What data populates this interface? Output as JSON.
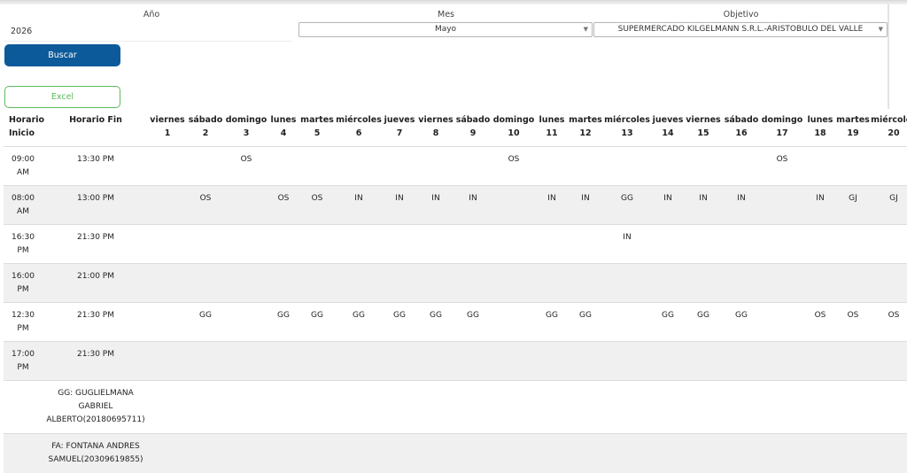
{
  "filters": {
    "year_label": "Año",
    "year_value": "2026",
    "month_label": "Mes",
    "month_value": "Mayo",
    "objective_label": "Objetivo",
    "objective_value": "SUPERMERCADO KILGELMANN S.R.L.-ARISTOBULO DEL VALLE",
    "caret_icon": "chevron-down-icon"
  },
  "buttons": {
    "buscar": "Buscar",
    "excel": "Excel",
    "buscar_color": "#0d5a9a",
    "excel_color": "#5cb85c"
  },
  "table": {
    "headers": {
      "start_line1": "Horario",
      "start_line2": "Inicio",
      "end": "Horario Fin"
    },
    "days": [
      {
        "name": "viernes",
        "num": "1"
      },
      {
        "name": "sábado",
        "num": "2"
      },
      {
        "name": "domingo",
        "num": "3"
      },
      {
        "name": "lunes",
        "num": "4"
      },
      {
        "name": "martes",
        "num": "5"
      },
      {
        "name": "miércoles",
        "num": "6"
      },
      {
        "name": "jueves",
        "num": "7"
      },
      {
        "name": "viernes",
        "num": "8"
      },
      {
        "name": "sábado",
        "num": "9"
      },
      {
        "name": "domingo",
        "num": "10"
      },
      {
        "name": "lunes",
        "num": "11"
      },
      {
        "name": "martes",
        "num": "12"
      },
      {
        "name": "miércoles",
        "num": "13"
      },
      {
        "name": "jueves",
        "num": "14"
      },
      {
        "name": "viernes",
        "num": "15"
      },
      {
        "name": "sábado",
        "num": "16"
      },
      {
        "name": "domingo",
        "num": "17"
      },
      {
        "name": "lunes",
        "num": "18"
      },
      {
        "name": "martes",
        "num": "19"
      },
      {
        "name": "miércoles",
        "num": "20"
      }
    ],
    "rows": [
      {
        "start_line1": "09:00",
        "start_line2": "AM",
        "end": "13:30 PM",
        "cells": [
          "",
          "",
          "OS",
          "",
          "",
          "",
          "",
          "",
          "",
          "OS",
          "",
          "",
          "",
          "",
          "",
          "",
          "OS",
          "",
          "",
          ""
        ]
      },
      {
        "start_line1": "08:00",
        "start_line2": "AM",
        "end": "13:00 PM",
        "cells": [
          "",
          "OS",
          "",
          "OS",
          "OS",
          "IN",
          "IN",
          "IN",
          "IN",
          "",
          "IN",
          "IN",
          "GG",
          "IN",
          "IN",
          "IN",
          "",
          "IN",
          "GJ",
          "GJ"
        ]
      },
      {
        "start_line1": "16:30",
        "start_line2": "PM",
        "end": "21:30 PM",
        "cells": [
          "",
          "",
          "",
          "",
          "",
          "",
          "",
          "",
          "",
          "",
          "",
          "",
          "IN",
          "",
          "",
          "",
          "",
          "",
          "",
          ""
        ]
      },
      {
        "start_line1": "16:00",
        "start_line2": "PM",
        "end": "21:00 PM",
        "cells": [
          "",
          "",
          "",
          "",
          "",
          "",
          "",
          "",
          "",
          "",
          "",
          "",
          "",
          "",
          "",
          "",
          "",
          "",
          "",
          ""
        ]
      },
      {
        "start_line1": "12:30",
        "start_line2": "PM",
        "end": "21:30 PM",
        "cells": [
          "",
          "GG",
          "",
          "GG",
          "GG",
          "GG",
          "GG",
          "GG",
          "GG",
          "",
          "GG",
          "GG",
          "",
          "GG",
          "GG",
          "GG",
          "",
          "OS",
          "OS",
          "OS"
        ]
      },
      {
        "start_line1": "17:00",
        "start_line2": "PM",
        "end": "21:30 PM",
        "cells": [
          "",
          "",
          "",
          "",
          "",
          "",
          "",
          "",
          "",
          "",
          "",
          "",
          "",
          "",
          "",
          "",
          "",
          "",
          "",
          ""
        ]
      }
    ],
    "legend": [
      {
        "lines": [
          "GG: GUGLIELMANA",
          "GABRIEL",
          "ALBERTO(20180695711)"
        ]
      },
      {
        "lines": [
          "FA: FONTANA ANDRES",
          "SAMUEL(20309619855)"
        ]
      }
    ]
  }
}
